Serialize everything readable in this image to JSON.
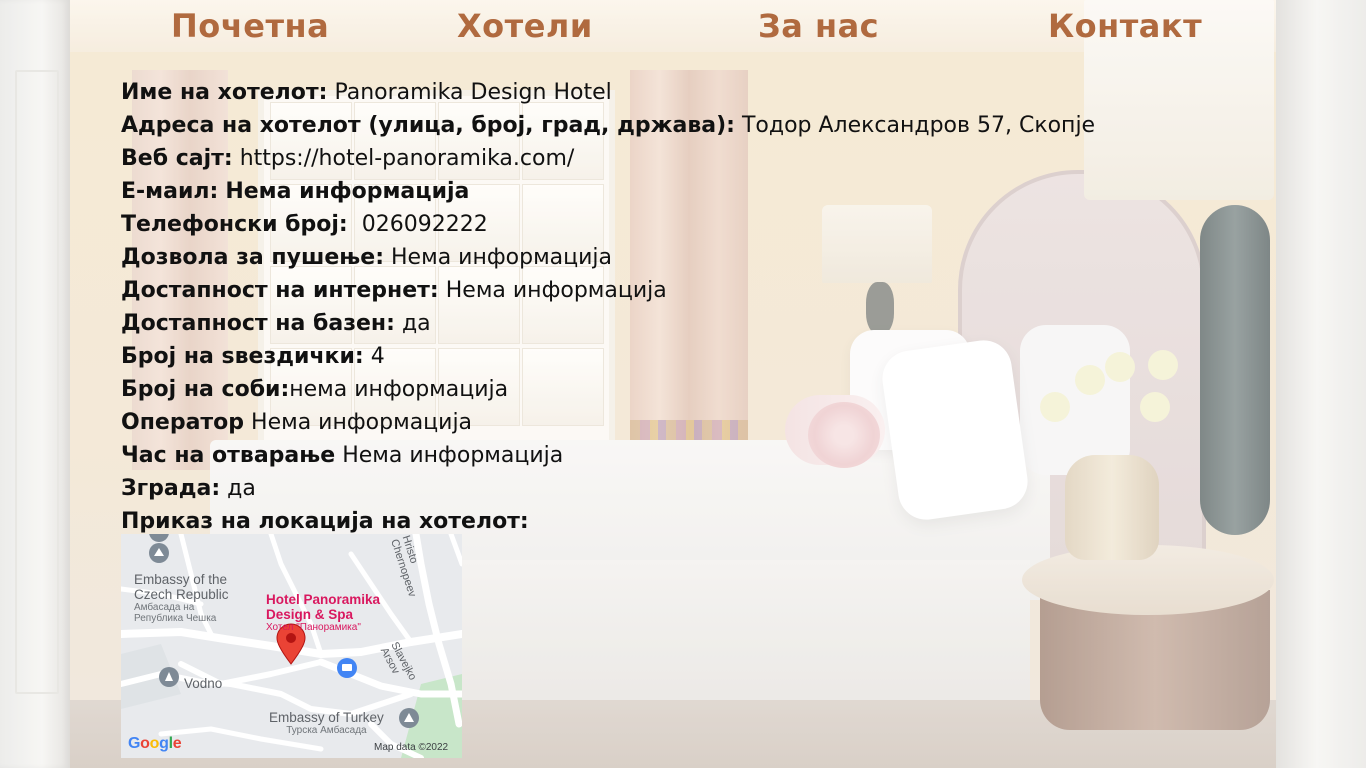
{
  "nav": {
    "items": [
      {
        "label": "Почетна"
      },
      {
        "label": "Хотели"
      },
      {
        "label": "За нас"
      },
      {
        "label": "Контакт"
      }
    ]
  },
  "hotel": {
    "name": {
      "label": "Име на хотелот:",
      "value": "Panoramika Design Hotel"
    },
    "address": {
      "label": "Адреса на хотелот (улица, број, град, држава):",
      "value": "Тодор Александров 57, Скопје"
    },
    "website": {
      "label": "Веб сајт:",
      "value": "https://hotel-panoramika.com/"
    },
    "email": {
      "label": "Е-маил:",
      "value": "Нема информација"
    },
    "phone": {
      "label": "Телефонски број:",
      "value": "026092222"
    },
    "smoking": {
      "label": "Дозвола за пушење:",
      "value": "Нема информација"
    },
    "internet": {
      "label": "Достапност на интернет:",
      "value": "Нема информација"
    },
    "pool": {
      "label": "Достапност на базен:",
      "value": "да"
    },
    "stars": {
      "label": "Број на ѕвездички:",
      "value": "4"
    },
    "rooms": {
      "label": "Број на соби:",
      "value": "нема информација"
    },
    "operator": {
      "label": "Оператор",
      "value": "Нема информација"
    },
    "opening": {
      "label": "Час на отварање",
      "value": "Нема информација"
    },
    "building": {
      "label": "Зграда:",
      "value": "да"
    },
    "location_label": "Приказ на локација на хотелот:"
  },
  "map": {
    "hotel_name_line1": "Hotel Panoramika",
    "hotel_name_line2": "Design & Spa",
    "hotel_name_local": "Хотел \"Панорамика\"",
    "embassy_cz_line1": "Embassy of the",
    "embassy_cz_line2": "Czech Republic",
    "embassy_cz_local1": "Амбасада на",
    "embassy_cz_local2": "Република Чешка",
    "vodno": "Vodno",
    "embassy_tr": "Embassy of Turkey",
    "embassy_tr_local": "Турска Амбасада",
    "road_1": "Hristo Chernopeev",
    "road_2": "Slavejko Arsov",
    "google": "Google",
    "map_data": "Map data ©2022",
    "colors": {
      "pin": "#ea4335",
      "hotel_label": "#d9185f",
      "park": "#c8e6c9",
      "poi": "#7e8a96",
      "shop": "#4285f4"
    }
  },
  "colors": {
    "nav": "#b06a3f",
    "text": "#111111"
  }
}
